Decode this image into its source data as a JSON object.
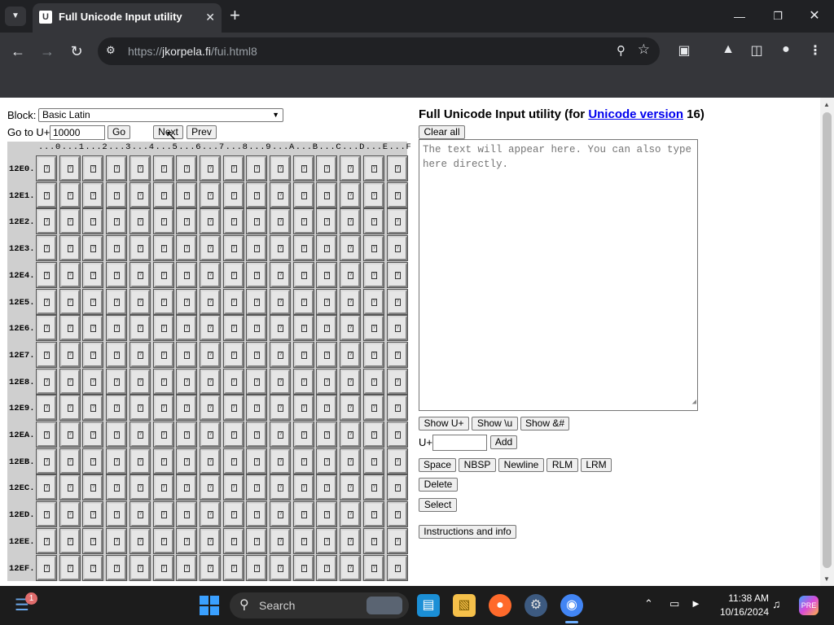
{
  "browser": {
    "tab_title": "Full Unicode Input utility",
    "tab_favicon": "U",
    "url_prefix": "https://",
    "url_host": "jkorpela.fi",
    "url_path": "/fui.html8"
  },
  "page": {
    "block_label": "Block:",
    "block_selected": "Basic Latin",
    "goto_label": "Go to U+",
    "goto_value": "10000",
    "go_label": "Go",
    "next_label": "Next",
    "prev_label": "Prev",
    "columns": [
      "0",
      "1",
      "2",
      "3",
      "4",
      "5",
      "6",
      "7",
      "8",
      "9",
      "A",
      "B",
      "C",
      "D",
      "E",
      "F"
    ],
    "rows": [
      "12E0.",
      "12E1.",
      "12E2.",
      "12E3.",
      "12E4.",
      "12E5.",
      "12E6.",
      "12E7.",
      "12E8.",
      "12E9.",
      "12EA.",
      "12EB.",
      "12EC.",
      "12ED.",
      "12EE.",
      "12EF."
    ],
    "glyph_char": "?",
    "title_prefix": "Full Unicode Input utility (for ",
    "title_link": "Unicode version",
    "title_suffix": " 16)",
    "clear_all_label": "Clear all",
    "textarea_placeholder": "The text will appear here. You can also type here directly.",
    "show_u_label": "Show U+",
    "show_backslash_u_label": "Show \\u",
    "show_amp_label": "Show &#",
    "uplus_label": "U+",
    "codepoint_value": "",
    "add_label": "Add",
    "space_label": "Space",
    "nbsp_label": "NBSP",
    "newline_label": "Newline",
    "rlm_label": "RLM",
    "lrm_label": "LRM",
    "delete_label": "Delete",
    "select_label": "Select",
    "instructions_label": "Instructions and info"
  },
  "taskbar": {
    "search_label": "Search",
    "widgets_badge": "1",
    "time": "11:38 AM",
    "date": "10/16/2024",
    "copilot_badge": "PRE"
  },
  "colors": {
    "tab_bar": "#202124",
    "toolbar": "#35363a",
    "link": "#0000ee",
    "grid_panel": "#cfcfcf",
    "taskbar": "#1c1c1c"
  }
}
